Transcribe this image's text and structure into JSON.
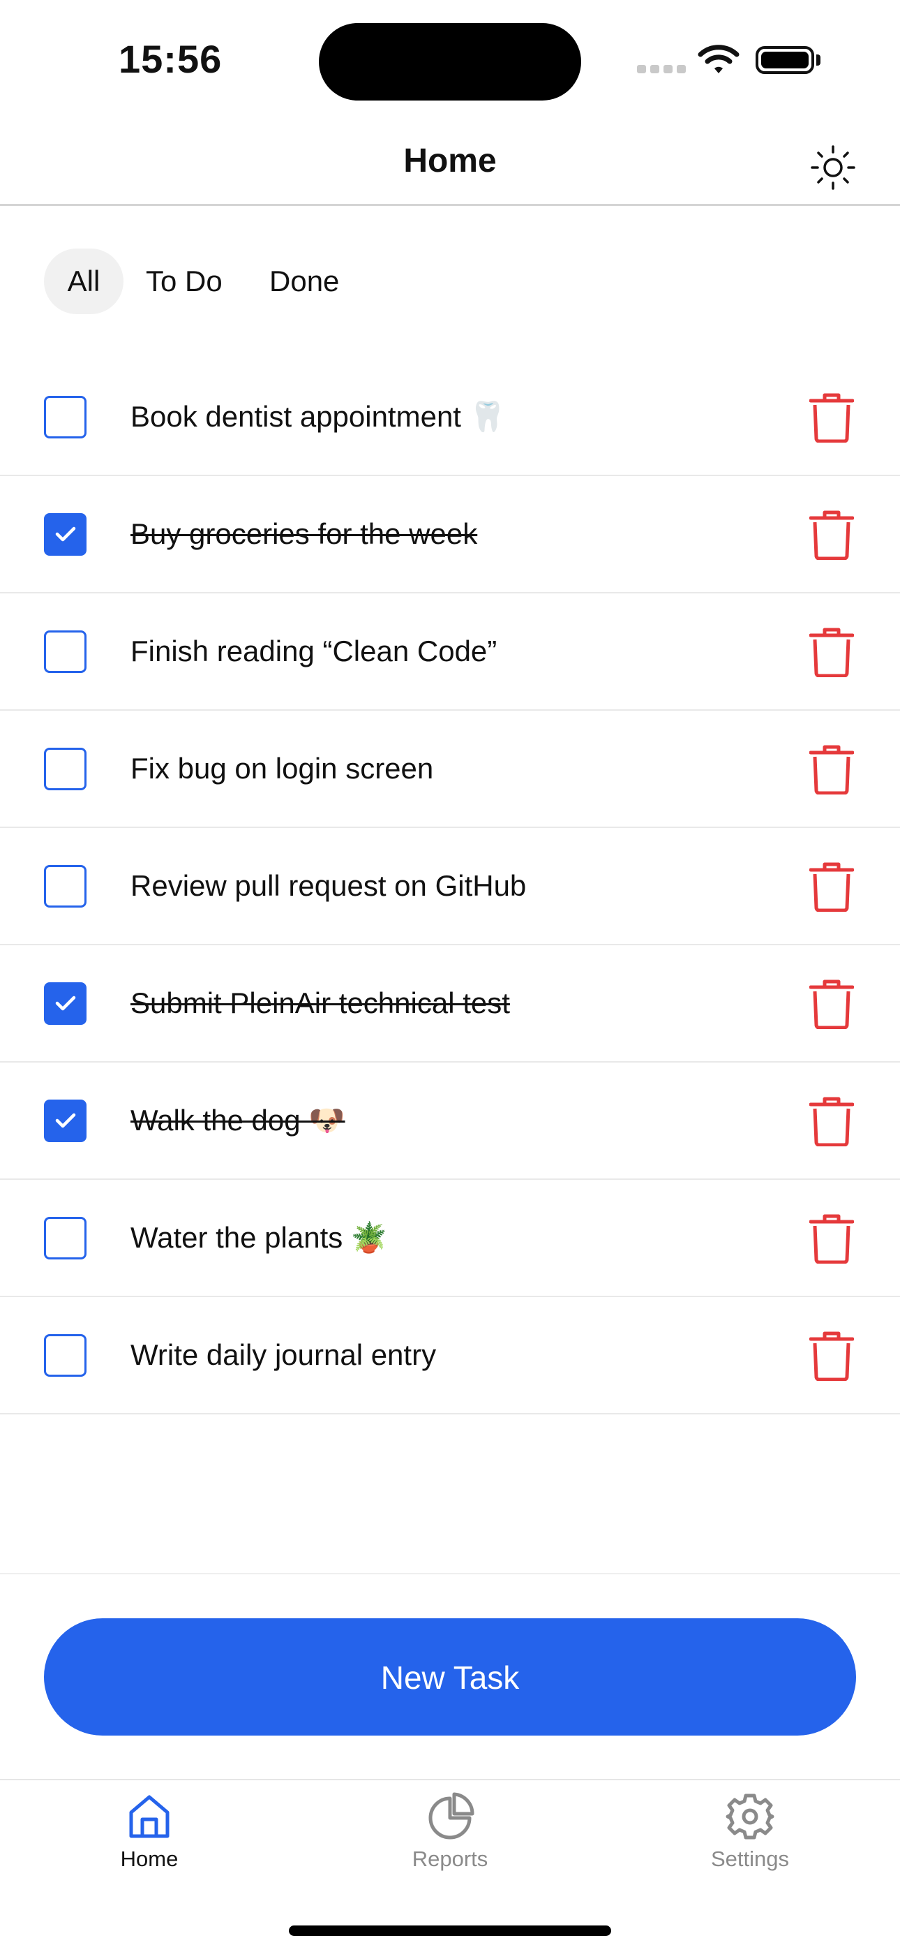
{
  "status_bar": {
    "time": "15:56"
  },
  "header": {
    "title": "Home",
    "theme_icon": "sun-icon"
  },
  "filters": {
    "all": "All",
    "todo": "To Do",
    "done": "Done",
    "selected": "All"
  },
  "tasks": [
    {
      "label": "Book dentist appointment 🦷",
      "done": false
    },
    {
      "label": "Buy groceries for the week",
      "done": true
    },
    {
      "label": "Finish reading “Clean Code”",
      "done": false
    },
    {
      "label": "Fix bug on login screen",
      "done": false
    },
    {
      "label": "Review pull request on GitHub",
      "done": false
    },
    {
      "label": "Submit PleinAir technical test",
      "done": true
    },
    {
      "label": "Walk the dog 🐶",
      "done": true
    },
    {
      "label": "Water the plants 🪴",
      "done": false
    },
    {
      "label": "Write daily journal entry",
      "done": false
    }
  ],
  "new_task_button": "New Task",
  "tab_bar": {
    "home": "Home",
    "reports": "Reports",
    "settings": "Settings",
    "selected": "Home"
  },
  "colors": {
    "accent": "#2563eb",
    "danger": "#e5393b",
    "muted": "#8a8a8a"
  }
}
